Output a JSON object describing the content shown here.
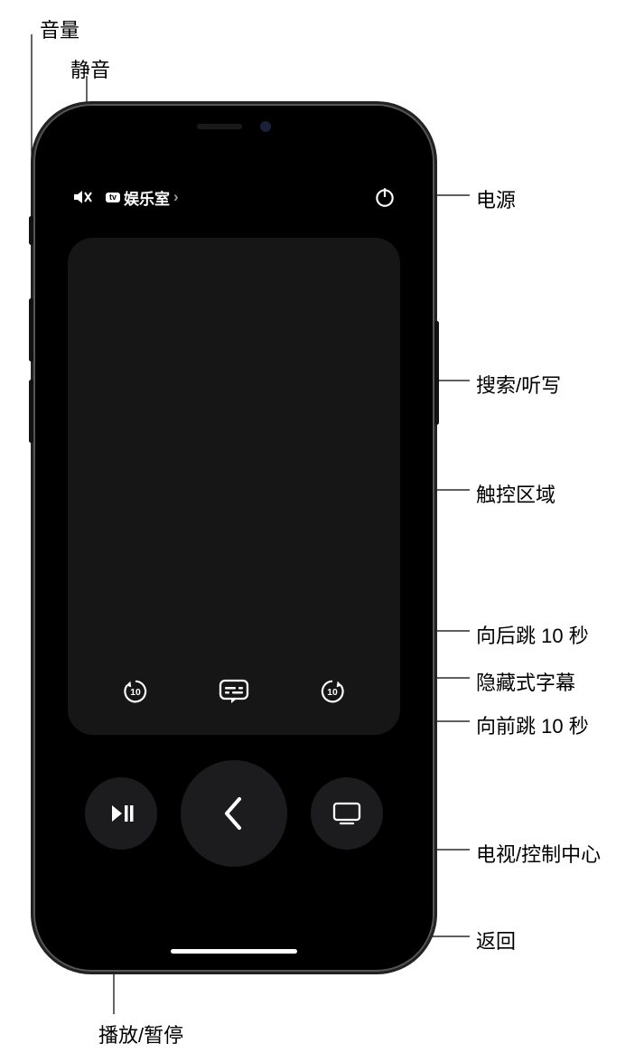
{
  "callouts": {
    "volume": "音量",
    "mute": "静音",
    "power": "电源",
    "search_dictation": "搜索/听写",
    "touch_area": "触控区域",
    "skip_back_10": "向后跳 10 秒",
    "closed_captions": "隐藏式字幕",
    "skip_fwd_10": "向前跳 10 秒",
    "tv_control_center": "电视/控制中心",
    "back": "返回",
    "play_pause": "播放/暂停"
  },
  "topbar": {
    "tv_badge": "tv",
    "device_label": "娱乐室",
    "chevron": "›"
  },
  "skip_seconds": "10"
}
